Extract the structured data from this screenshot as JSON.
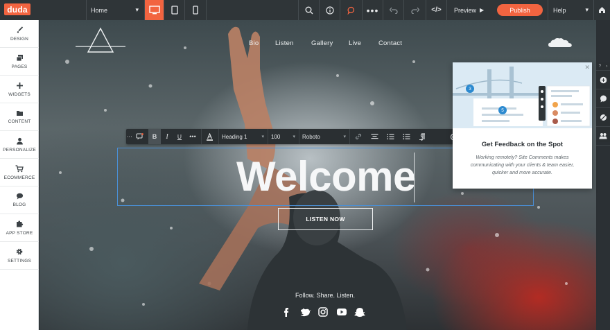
{
  "topbar": {
    "logo": "duda",
    "page_select": "Home",
    "preview_label": "Preview",
    "publish_label": "Publish",
    "help_label": "Help"
  },
  "sidebar": {
    "items": [
      {
        "label": "DESIGN",
        "icon": "brush-icon"
      },
      {
        "label": "PAGES",
        "icon": "pages-icon"
      },
      {
        "label": "WIDGETS",
        "icon": "plus-icon"
      },
      {
        "label": "CONTENT",
        "icon": "folder-icon"
      },
      {
        "label": "PERSONALIZE",
        "icon": "user-icon"
      },
      {
        "label": "ECOMMERCE",
        "icon": "cart-icon"
      },
      {
        "label": "BLOG",
        "icon": "chat-bubble-icon"
      },
      {
        "label": "APP STORE",
        "icon": "puzzle-icon"
      },
      {
        "label": "SETTINGS",
        "icon": "gear-icon"
      }
    ]
  },
  "site": {
    "nav": [
      "Bio",
      "Listen",
      "Gallery",
      "Live",
      "Contact"
    ],
    "heading": "Welcome",
    "button_label": "LISTEN NOW",
    "footer_text": "Follow. Share. Listen.",
    "social_icons": [
      "facebook-icon",
      "twitter-icon",
      "instagram-icon",
      "youtube-icon",
      "snapchat-icon"
    ]
  },
  "text_toolbar": {
    "style_value": "Heading 1",
    "size_value": "100",
    "font_value": "Roboto"
  },
  "popup": {
    "title": "Get Feedback on the Spot",
    "body": "Working remotely? Site Comments makes communicating with your clients & team easier, quicker and more accurate.",
    "badge_left": "3",
    "badge_center": "5"
  },
  "colors": {
    "accent": "#f26440",
    "topbar": "#2f3538",
    "selection": "#4a8fd6"
  }
}
